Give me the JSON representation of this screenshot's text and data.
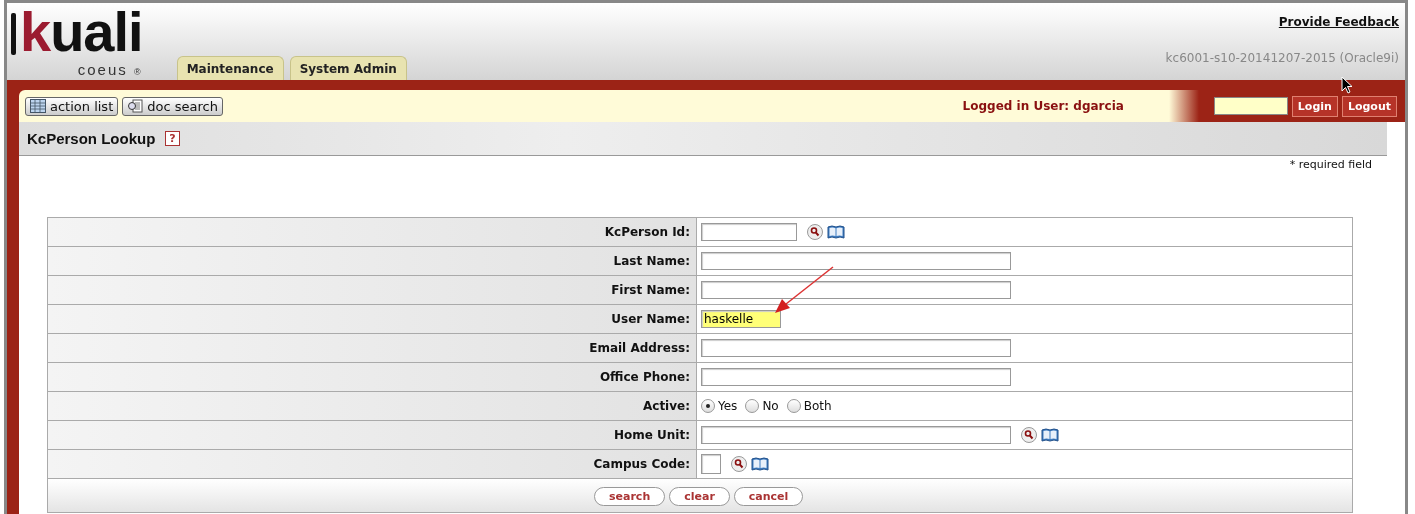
{
  "logo": {
    "name": "kuali",
    "sub": "coeus",
    "mark": "®"
  },
  "header": {
    "feedback_link": "Provide Feedback",
    "build": "kc6001-s10-20141207-2015 (Oracle9i)"
  },
  "tabs": [
    {
      "label": "Maintenance",
      "selected": false
    },
    {
      "label": "System Admin",
      "selected": false
    }
  ],
  "toolbar": {
    "buttons": [
      {
        "label": "action list",
        "kind": "list"
      },
      {
        "label": "doc search",
        "kind": "search"
      }
    ],
    "logged_in": "Logged in User: dgarcia",
    "login_button": "Login",
    "logout_button": "Logout"
  },
  "page_title": "KcPerson Lookup",
  "help_icon": "?",
  "required_note": "* required field",
  "fields": [
    {
      "label": "KcPerson Id:",
      "kind": "short",
      "lookup": true
    },
    {
      "label": "Last Name:",
      "kind": "long",
      "lookup": false
    },
    {
      "label": "First Name:",
      "kind": "long",
      "lookup": false
    },
    {
      "label": "User Name:",
      "kind": "short",
      "value": "haskelle",
      "highlighted": true,
      "lookup": false
    },
    {
      "label": "Email Address:",
      "kind": "long",
      "lookup": false
    },
    {
      "label": "Office Phone:",
      "kind": "long",
      "lookup": false
    },
    {
      "label": "Active:",
      "kind": "radio",
      "options": [
        {
          "label": "Yes",
          "selected": true
        },
        {
          "label": "No",
          "selected": false
        },
        {
          "label": "Both",
          "selected": false
        }
      ]
    },
    {
      "label": "Home Unit:",
      "kind": "long",
      "lookup": true
    },
    {
      "label": "Campus Code:",
      "kind": "code",
      "lookup": true
    }
  ],
  "actions": [
    "search",
    "clear",
    "cancel"
  ]
}
